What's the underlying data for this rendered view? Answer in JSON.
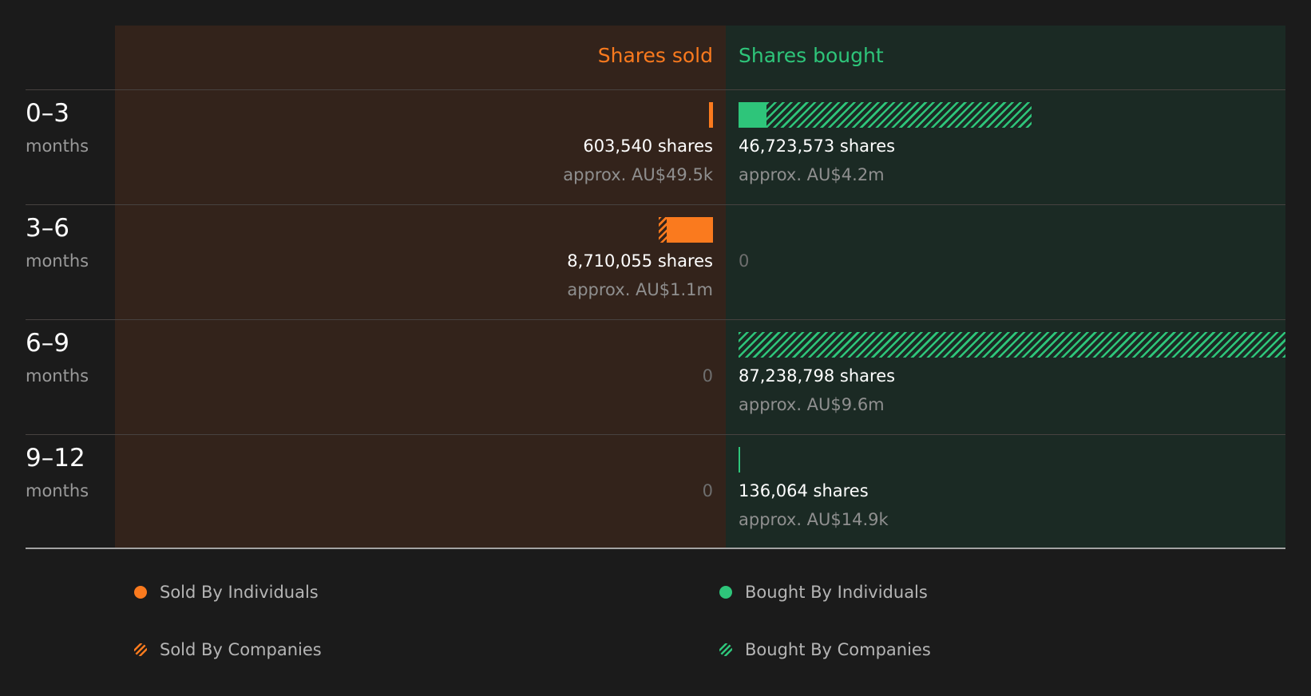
{
  "colors": {
    "sold": "#fa7a1e",
    "bought": "#2ec57a"
  },
  "headers": {
    "sold": "Shares sold",
    "bought": "Shares bought"
  },
  "chart_data": {
    "type": "bar",
    "orientation": "horizontal-diverging",
    "max_shares": 87238798,
    "rows": [
      {
        "range": "0–3",
        "unit": "months",
        "sold": {
          "individuals": 603540,
          "companies": 0,
          "shares_text": "603,540 shares",
          "approx": "approx. AU$49.5k",
          "zero": null
        },
        "bought": {
          "individuals": 4515000,
          "companies": 42208573,
          "shares_text": "46,723,573 shares",
          "approx": "approx. AU$4.2m",
          "zero": null
        }
      },
      {
        "range": "3–6",
        "unit": "months",
        "sold": {
          "individuals": 7386000,
          "companies": 1324055,
          "shares_text": "8,710,055 shares",
          "approx": "approx. AU$1.1m",
          "zero": null
        },
        "bought": {
          "individuals": 0,
          "companies": 0,
          "shares_text": null,
          "approx": null,
          "zero": "0"
        }
      },
      {
        "range": "6–9",
        "unit": "months",
        "sold": {
          "individuals": 0,
          "companies": 0,
          "shares_text": null,
          "approx": null,
          "zero": "0"
        },
        "bought": {
          "individuals": 0,
          "companies": 87238798,
          "shares_text": "87,238,798 shares",
          "approx": "approx. AU$9.6m",
          "zero": null
        }
      },
      {
        "range": "9–12",
        "unit": "months",
        "sold": {
          "individuals": 0,
          "companies": 0,
          "shares_text": null,
          "approx": null,
          "zero": "0"
        },
        "bought": {
          "individuals": 136064,
          "companies": 0,
          "shares_text": "136,064 shares",
          "approx": "approx. AU$14.9k",
          "zero": null
        }
      }
    ],
    "legend": [
      {
        "label": "Sold By Individuals",
        "style": "solid",
        "color": "#fa7a1e"
      },
      {
        "label": "Bought By Individuals",
        "style": "solid",
        "color": "#2ec57a"
      },
      {
        "label": "Sold By Companies",
        "style": "hatched",
        "color": "#fa7a1e"
      },
      {
        "label": "Bought By Companies",
        "style": "hatched",
        "color": "#2ec57a"
      }
    ]
  }
}
